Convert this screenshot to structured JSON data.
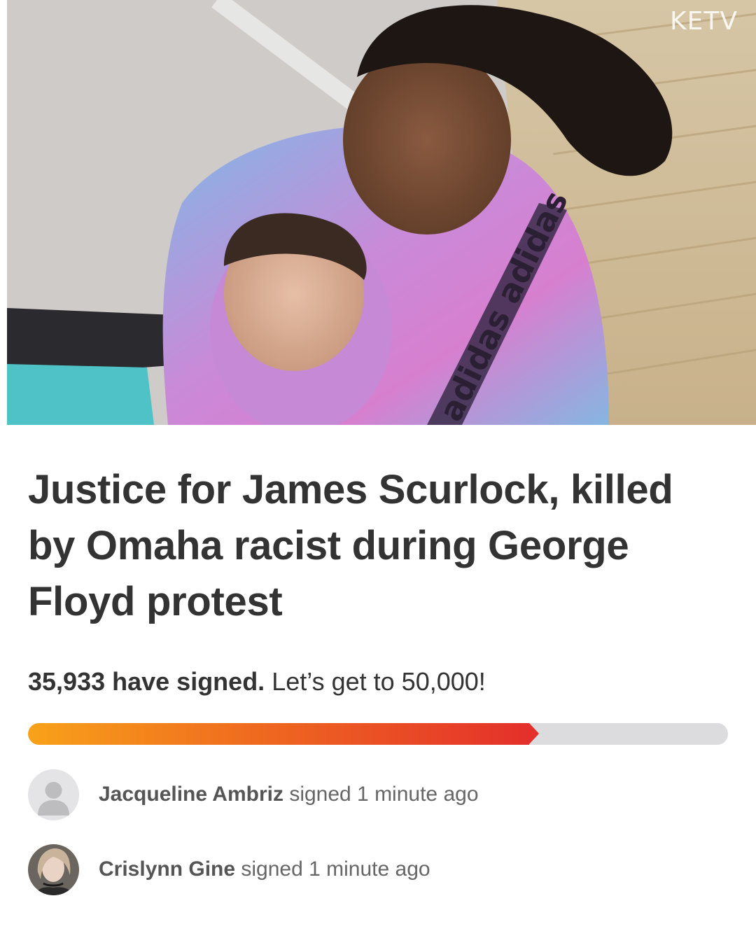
{
  "hero": {
    "watermark": "KETV",
    "shirt_text": "adidas adidas"
  },
  "petition": {
    "title": "Justice for James Scurlock, killed by Omaha racist during George Floyd protest",
    "signed_count": "35,933 have signed.",
    "goal_text": "Let’s get to 50,000!",
    "progress_percent": 73
  },
  "signers": [
    {
      "name": "Jacqueline Ambriz",
      "action": "signed 1 minute ago",
      "avatar": "default-avatar-icon"
    },
    {
      "name": "Crislynn Gine",
      "action": "signed 1 minute ago",
      "avatar": "photo"
    }
  ],
  "colors": {
    "progress_start": "#f8a21a",
    "progress_end": "#e4302b",
    "progress_track": "#dcdbde",
    "text": "#333333"
  }
}
